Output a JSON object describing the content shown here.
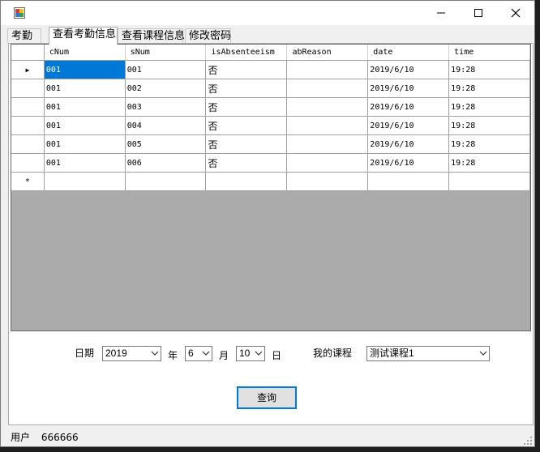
{
  "window": {
    "title": "",
    "controls": {
      "minimize": "—",
      "maximize": "☐",
      "close": "✕"
    }
  },
  "tabs": [
    {
      "label": "考勤",
      "active": false
    },
    {
      "label": "查看考勤信息",
      "active": true
    },
    {
      "label": "查看课程信息",
      "active": false
    },
    {
      "label": "修改密码",
      "active": false
    }
  ],
  "grid": {
    "columns": [
      "cNum",
      "sNum",
      "isAbsenteeism",
      "abReason",
      "date",
      "time"
    ],
    "rows": [
      [
        "001",
        "001",
        "否",
        "",
        "2019/6/10",
        "19:28"
      ],
      [
        "001",
        "002",
        "否",
        "",
        "2019/6/10",
        "19:28"
      ],
      [
        "001",
        "003",
        "否",
        "",
        "2019/6/10",
        "19:28"
      ],
      [
        "001",
        "004",
        "否",
        "",
        "2019/6/10",
        "19:28"
      ],
      [
        "001",
        "005",
        "否",
        "",
        "2019/6/10",
        "19:28"
      ],
      [
        "001",
        "006",
        "否",
        "",
        "2019/6/10",
        "19:28"
      ]
    ],
    "current_row_marker": "▶",
    "new_row_marker": "*"
  },
  "form": {
    "date_label": "日期",
    "year_value": "2019",
    "year_unit": "年",
    "month_value": "6",
    "month_unit": "月",
    "day_value": "10",
    "day_unit": "日",
    "course_label": "我的课程",
    "course_value": "测试课程1",
    "query_button": "查询"
  },
  "status": {
    "user_label": "用户",
    "user_value": "666666"
  },
  "colors": {
    "selection": "#0078d7",
    "grid_background": "#ababab",
    "focus_border": "#0078d7"
  }
}
